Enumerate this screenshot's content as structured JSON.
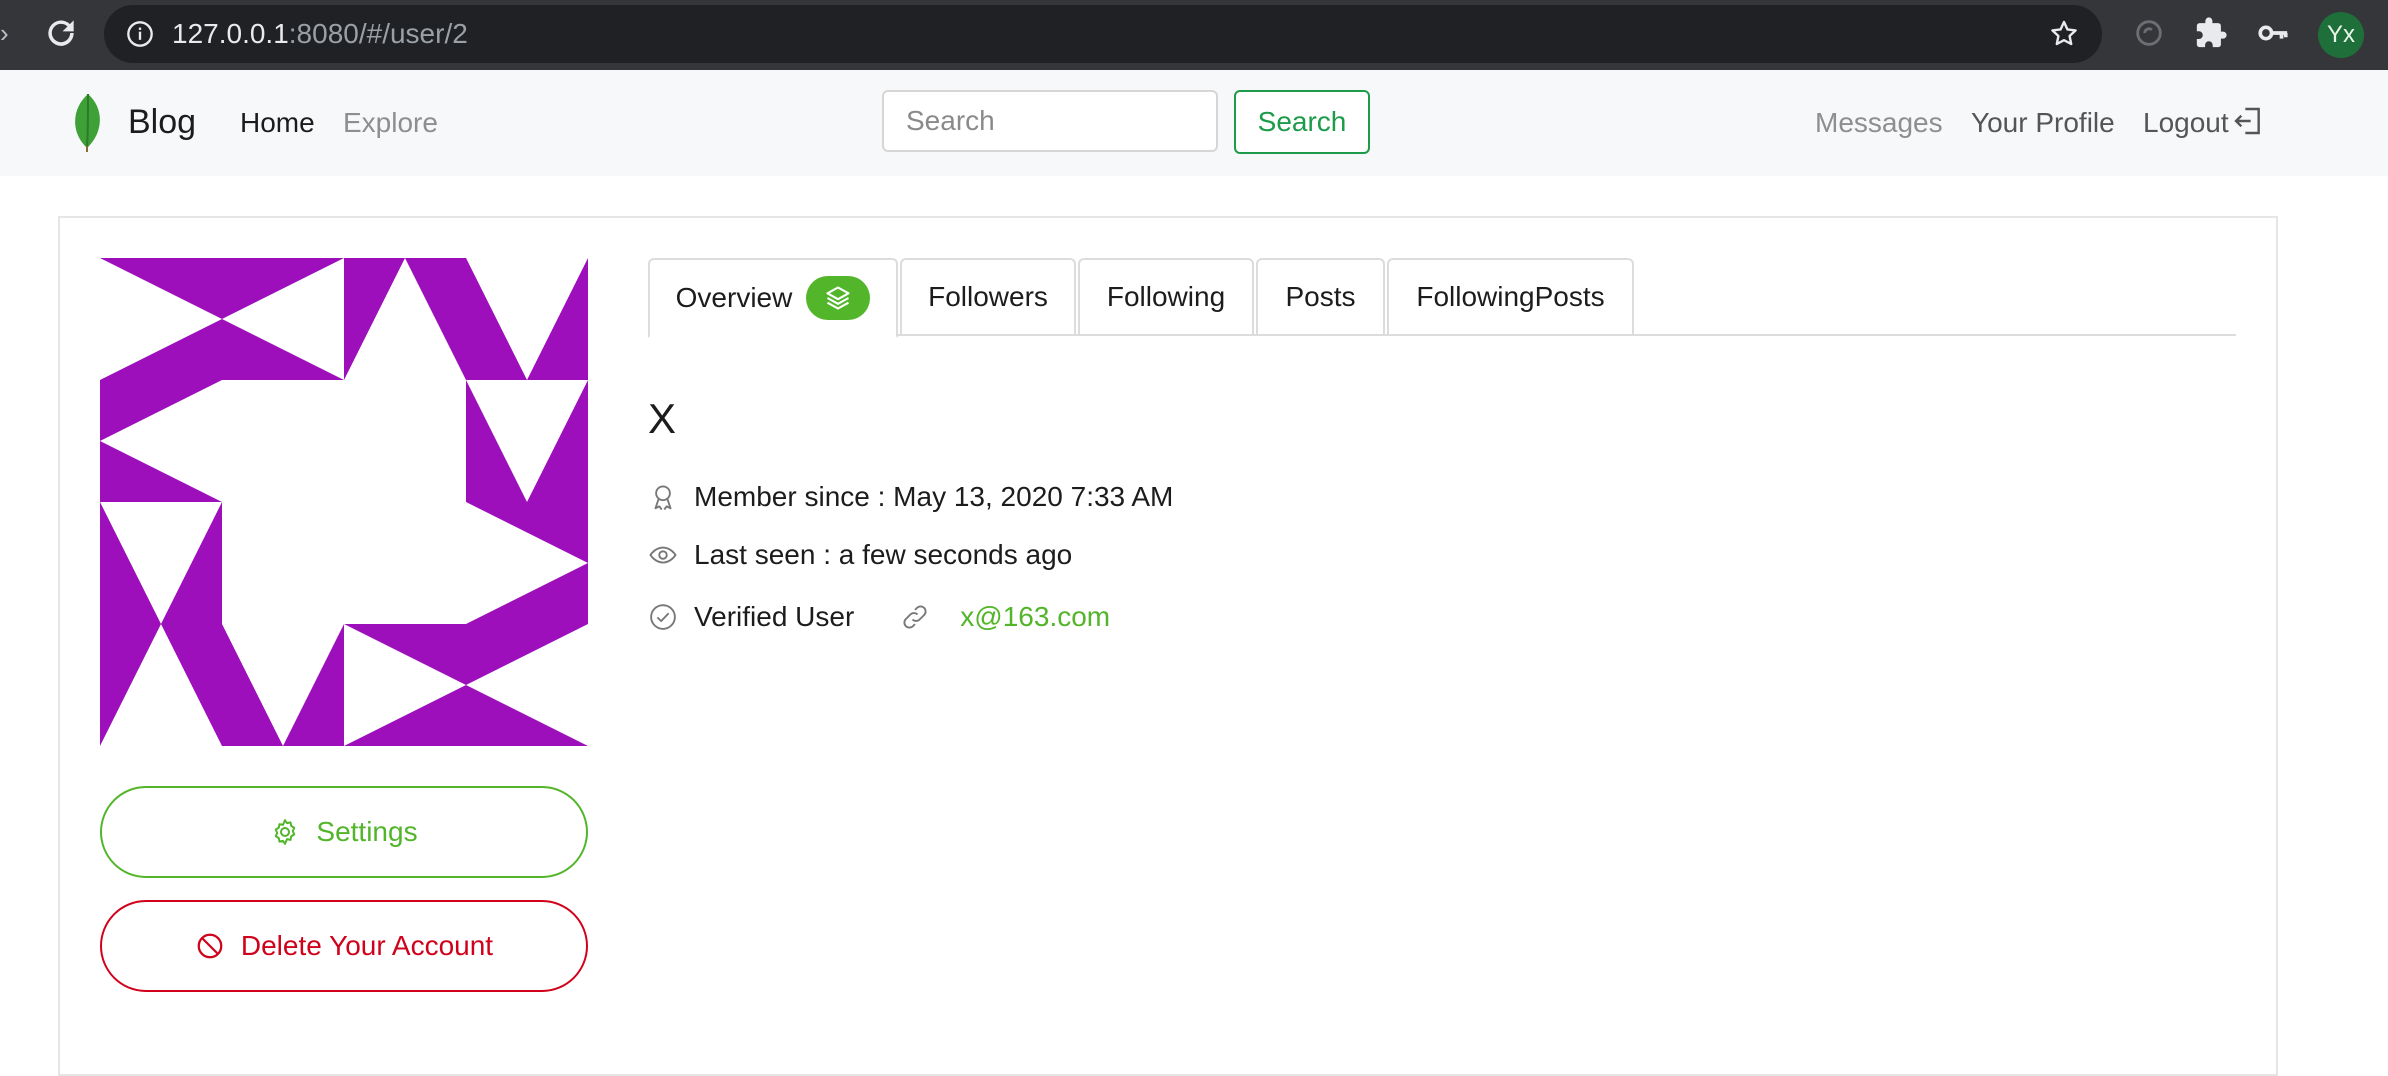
{
  "browser": {
    "url_host": "127.0.0.1",
    "url_rest": ":8080/#/user/2",
    "profile_initials": "Yx"
  },
  "navbar": {
    "brand": "Blog",
    "links": {
      "home": "Home",
      "explore": "Explore"
    },
    "search": {
      "placeholder": "Search",
      "button_label": "Search"
    },
    "right_links": {
      "messages": "Messages",
      "profile": "Your Profile",
      "logout": "Logout"
    }
  },
  "profile": {
    "buttons": {
      "settings": "Settings",
      "delete": "Delete Your Account"
    },
    "tabs": [
      "Overview",
      "Followers",
      "Following",
      "Posts",
      "FollowingPosts"
    ],
    "name": "X",
    "member_since": "Member since : May 13, 2020 7:33 AM",
    "last_seen": "Last seen : a few seconds ago",
    "verified": "Verified User",
    "email": "x@163.com"
  },
  "colors": {
    "accent_green": "#52b52a",
    "search_green": "#1e9b4a",
    "danger_red": "#d0021b",
    "identicon_purple": "#9c0fba"
  }
}
